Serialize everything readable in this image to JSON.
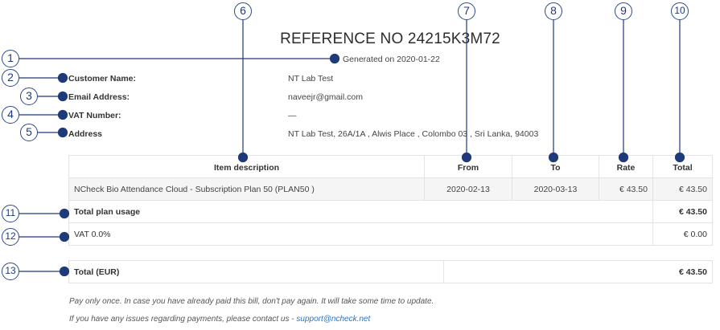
{
  "header": {
    "reference": "REFERENCE NO 24215K3M72",
    "generated": "Generated on 2020-01-22"
  },
  "customer": {
    "name_label": "Customer Name:",
    "name_value": "NT Lab Test",
    "email_label": "Email Address:",
    "email_value": "naveejr@gmail.com",
    "vat_label": "VAT Number:",
    "vat_value": "—",
    "address_label": "Address",
    "address_value": "NT Lab Test, 26A/1A , Alwis Place , Colombo 03 , Sri Lanka, 94003"
  },
  "table": {
    "headers": {
      "description": "Item description",
      "from": "From",
      "to": "To",
      "rate": "Rate",
      "total": "Total"
    },
    "item": {
      "description": "NCheck Bio Attendance Cloud - Subscription Plan 50 (PLAN50 )",
      "from": "2020-02-13",
      "to": "2020-03-13",
      "rate": "€ 43.50",
      "total": "€ 43.50"
    },
    "plan_usage": {
      "label": "Total plan usage",
      "value": "€ 43.50"
    },
    "vat": {
      "label": "VAT 0.0%",
      "value": "€ 0.00"
    }
  },
  "total": {
    "label": "Total (EUR)",
    "value": "€ 43.50"
  },
  "notes": {
    "pay_once": "Pay only once. In case you have already paid this bill, don't pay again. It will take some time to update.",
    "issues": "If you have any issues regarding payments, please contact us - ",
    "support_email": "support@ncheck.net"
  },
  "callouts": {
    "c1": "1",
    "c2": "2",
    "c3": "3",
    "c4": "4",
    "c5": "5",
    "c6": "6",
    "c7": "7",
    "c8": "8",
    "c9": "9",
    "c10": "10",
    "c11": "11",
    "c12": "12",
    "c13": "13"
  },
  "colors": {
    "callout": "#1f3a7a",
    "link": "#2a72c9"
  }
}
